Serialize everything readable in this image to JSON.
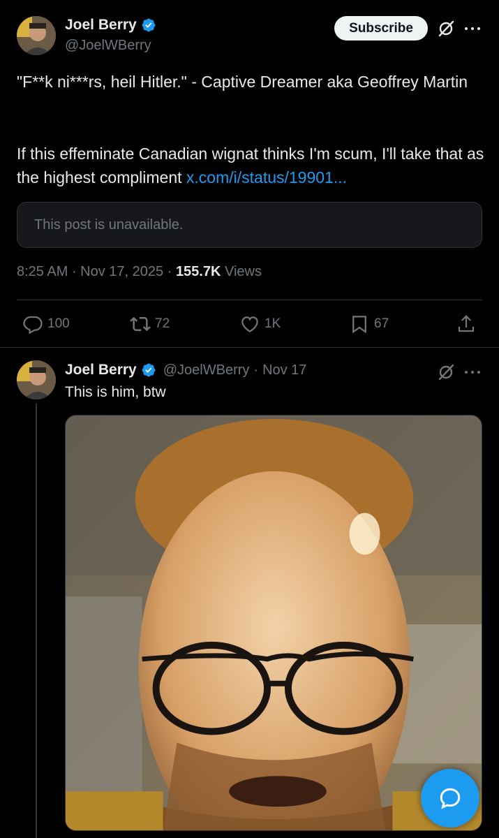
{
  "main_post": {
    "author_name": "Joel Berry",
    "author_handle": "@JoelWBerry",
    "subscribe_label": "Subscribe",
    "text_line1": "\"F**k ni***rs, heil Hitler.\" - Captive Dreamer aka Geoffrey Martin",
    "text_line2": "If this effeminate Canadian wignat thinks I'm scum, I'll take that as the highest compliment ",
    "link_text": "x.com/i/status/19901...",
    "quoted_unavailable": "This post is unavailable.",
    "time": "8:25 AM",
    "date": "Nov 17, 2025",
    "views_count": "155.7K",
    "views_label": "Views",
    "replies": "100",
    "reposts": "72",
    "likes": "1K",
    "bookmarks": "67"
  },
  "reply_post": {
    "author_name": "Joel Berry",
    "author_handle": "@JoelWBerry",
    "date": "Nov 17",
    "text": "This is him, btw"
  },
  "icons": {
    "verified": "verified-badge-icon",
    "grok": "grok-icon",
    "more": "more-icon",
    "reply": "reply-icon",
    "repost": "repost-icon",
    "like": "heart-icon",
    "bookmark": "bookmark-icon",
    "share": "share-icon",
    "compose": "chat-bubble-icon"
  },
  "colors": {
    "background": "#000000",
    "text": "#e7e9ea",
    "muted": "#71767b",
    "accent": "#1d9bf0"
  }
}
